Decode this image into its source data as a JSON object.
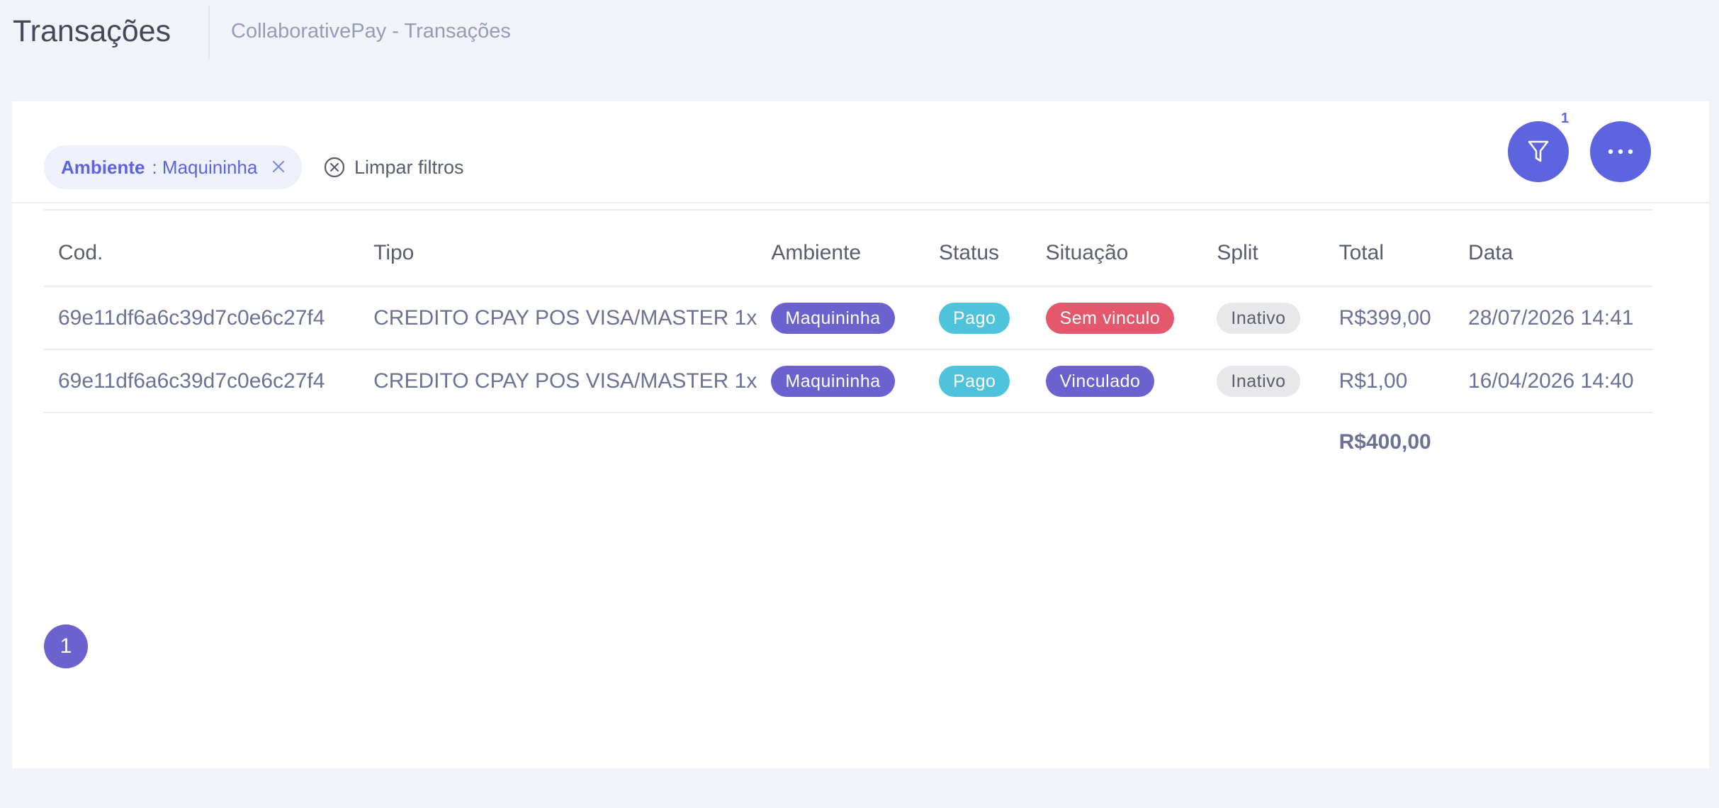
{
  "header": {
    "title": "Transações",
    "breadcrumb": "CollaborativePay - Transações"
  },
  "toolbar": {
    "filter_count": "1",
    "filter_icon": "filter-icon",
    "more_icon": "more-horizontal-icon"
  },
  "filters": {
    "active": [
      {
        "key": "Ambiente",
        "value": ": Maquininha"
      }
    ],
    "clear_label": "Limpar filtros"
  },
  "table": {
    "columns": [
      "Cod.",
      "Tipo",
      "Ambiente",
      "Status",
      "Situação",
      "Split",
      "Total",
      "Data"
    ],
    "rows": [
      {
        "cod": "69e11df6a6c39d7c0e6c27f4",
        "tipo": "CREDITO CPAY POS VISA/MASTER 1x",
        "ambiente": "Maquininha",
        "status": "Pago",
        "situacao": "Sem vinculo",
        "split": "Inativo",
        "total": "R$399,00",
        "data": "28/07/2026 14:41"
      },
      {
        "cod": "69e11df6a6c39d7c0e6c27f4",
        "tipo": "CREDITO CPAY POS VISA/MASTER 1x",
        "ambiente": "Maquininha",
        "status": "Pago",
        "situacao": "Vinculado",
        "split": "Inativo",
        "total": "R$1,00",
        "data": "16/04/2026 14:40"
      }
    ],
    "sum_total": "R$400,00"
  },
  "pagination": {
    "current_page": "1"
  },
  "colors": {
    "accent": "#5d64e0",
    "badge_ambiente": "#6b61cf",
    "badge_pago": "#4fc3dc",
    "badge_sem_vinculo": "#e5576d",
    "badge_vinculado": "#6b61cf",
    "badge_inativo": "#e8e8ea"
  }
}
